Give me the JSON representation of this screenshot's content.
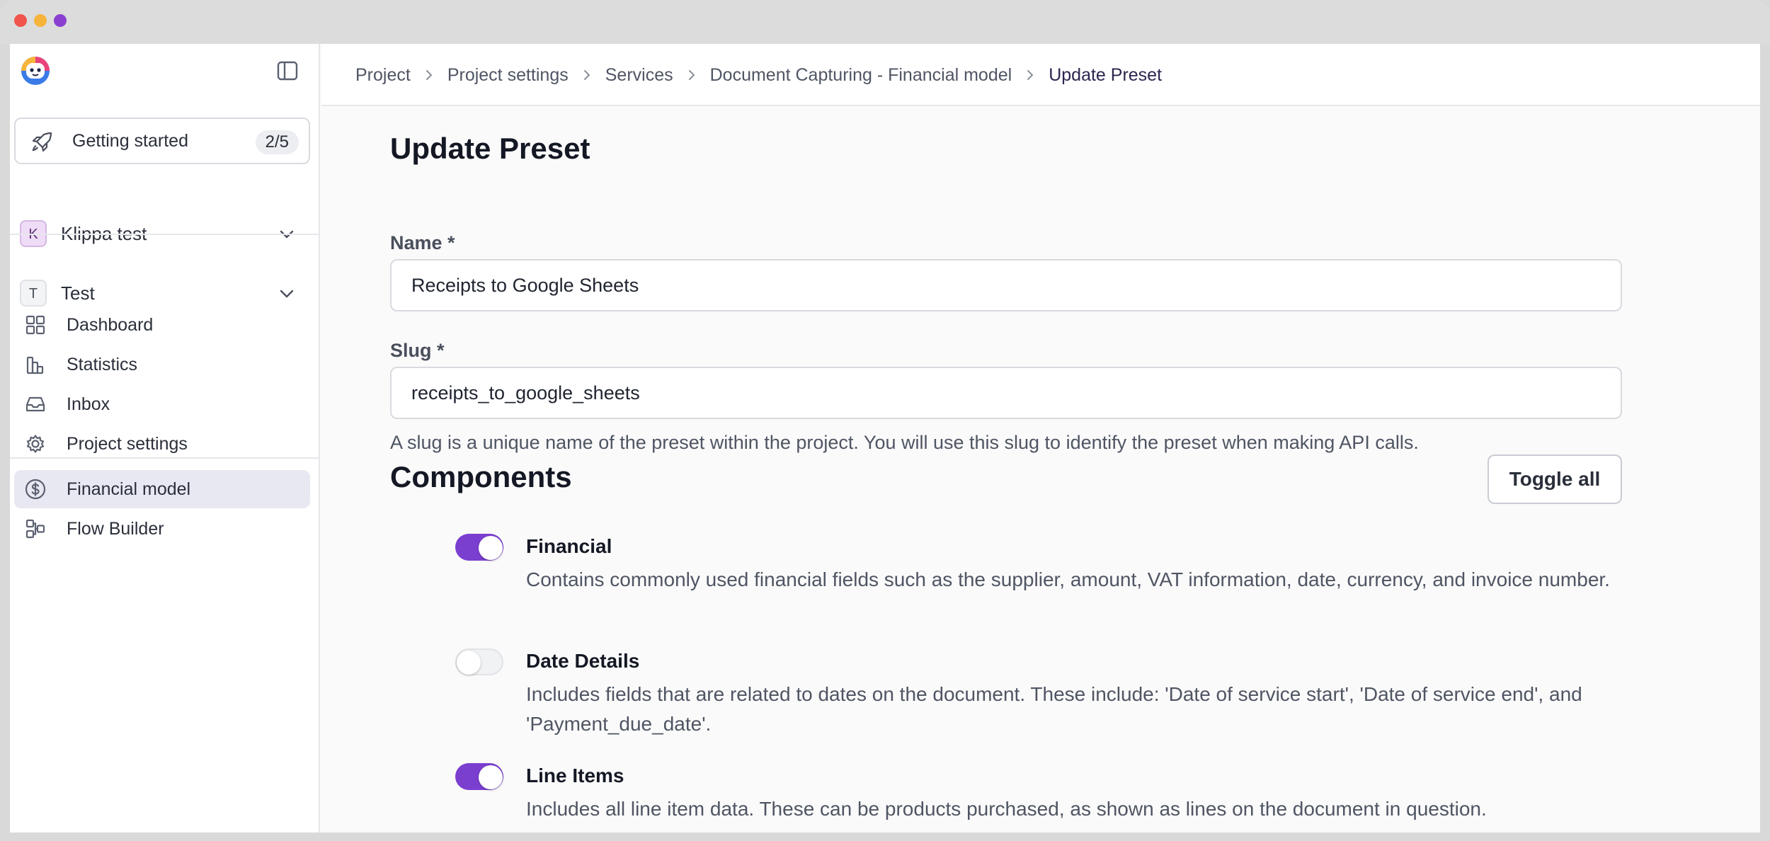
{
  "app": {
    "colors": {
      "accent": "#7b3fd0",
      "active_nav_bg": "#e8e8f3"
    }
  },
  "sidebar": {
    "getting_started": {
      "label": "Getting started",
      "progress": "2/5"
    },
    "organization": {
      "avatar": "K",
      "label": "Klippa test"
    },
    "project": {
      "avatar": "T",
      "label": "Test"
    },
    "items": [
      {
        "label": "Dashboard",
        "icon": "grid-icon"
      },
      {
        "label": "Statistics",
        "icon": "bar-chart-icon"
      },
      {
        "label": "Inbox",
        "icon": "inbox-icon"
      },
      {
        "label": "Project settings",
        "icon": "gear-icon"
      }
    ],
    "services": [
      {
        "label": "Financial model",
        "icon": "dollar-circle-icon",
        "active": true
      },
      {
        "label": "Flow Builder",
        "icon": "flow-icon",
        "active": false
      }
    ]
  },
  "breadcrumb": [
    "Project",
    "Project settings",
    "Services",
    "Document Capturing - Financial model",
    "Update Preset"
  ],
  "page": {
    "title": "Update Preset",
    "name_label": "Name *",
    "name_value": "Receipts to Google Sheets",
    "slug_label": "Slug *",
    "slug_value": "receipts_to_google_sheets",
    "slug_help": "A slug is a unique name of the preset within the project. You will use this slug to identify the preset when making API calls.",
    "components_title": "Components",
    "toggle_all_label": "Toggle all"
  },
  "components": [
    {
      "title": "Financial",
      "enabled": true,
      "description": "Contains commonly used financial fields such as the supplier, amount, VAT information, date, currency, and invoice number."
    },
    {
      "title": "Date Details",
      "enabled": false,
      "description": "Includes fields that are related to dates on the document. These include: 'Date of service start', 'Date of service end', and 'Payment_due_date'."
    },
    {
      "title": "Line Items",
      "enabled": true,
      "description": "Includes all line item data. These can be products purchased, as shown as lines on the document in question."
    }
  ]
}
